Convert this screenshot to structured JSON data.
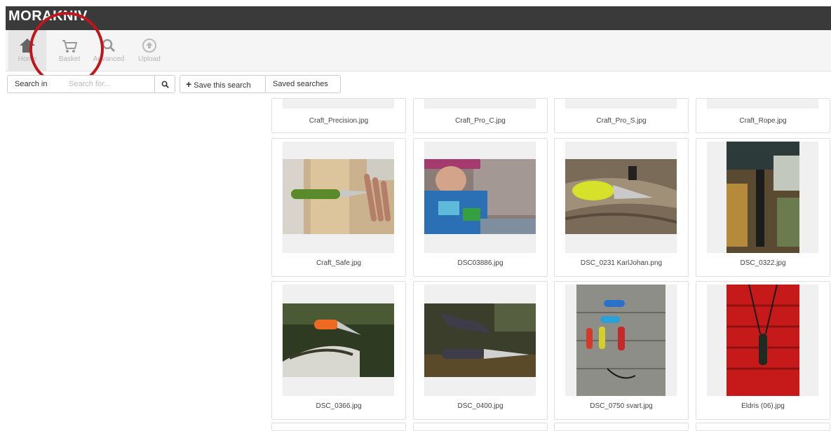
{
  "app": {
    "logo": "MORAKNIV"
  },
  "toolbar": [
    {
      "label": "Home",
      "icon": "home-icon",
      "active": true
    },
    {
      "label": "Basket",
      "icon": "basket-icon",
      "active": false
    },
    {
      "label": "Advanced",
      "icon": "search-icon",
      "active": false
    },
    {
      "label": "Upload",
      "icon": "upload-icon",
      "active": false
    }
  ],
  "search": {
    "search_in_label": "Search in",
    "placeholder": "Search for...",
    "value": "",
    "go_icon": "search-icon",
    "save_label": "Save this search",
    "saved_label": "Saved searches"
  },
  "gallery": {
    "row1": [
      "Craft_Precision.jpg",
      "Craft_Pro_C.jpg",
      "Craft_Pro_S.jpg",
      "Craft_Rope.jpg"
    ],
    "row2": [
      "Craft_Safe.jpg",
      "DSC03886.jpg",
      "DSC_0231 KarlJohan.png",
      "DSC_0322.jpg"
    ],
    "row3": [
      "DSC_0366.jpg",
      "DSC_0400.jpg",
      "DSC_0750 svart.jpg",
      "Eldris (06).jpg"
    ]
  },
  "colors": {
    "topbar": "#3a3a3a",
    "annotation": "#c0161b"
  }
}
